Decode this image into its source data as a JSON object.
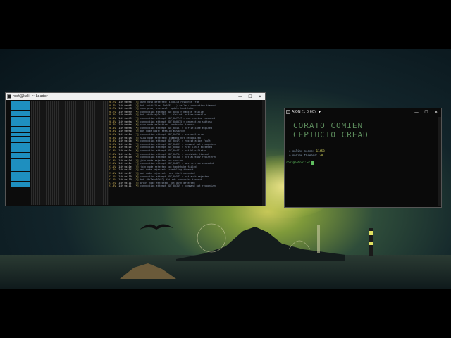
{
  "left_window": {
    "title": "root@kali: ~ Loader",
    "controls": [
      "—",
      "☐",
      "✕"
    ],
    "log": [
      {
        "pct": "20.7%",
        "time": "[14H 0x0f8]",
        "tag": "[!]",
        "msg": "auth host detected: invalid response from"
      },
      {
        "pct": "20.7%",
        "time": "[14H 0x0f8]",
        "tag": "[!]",
        "msg": "bot initialize( 0xA7F... ) failed: connection timeout"
      },
      {
        "pct": "20.7%",
        "time": "[14H 0x0f8]",
        "tag": "[!]",
        "msg": "node proxy protocol: update handshake"
      },
      {
        "pct": "20.7%",
        "time": "[14H 0x0f9]",
        "tag": "[*]",
        "msg": "connection attempt BOT_0x51 > handle resolve"
      },
      {
        "pct": "20.8%",
        "time": "[14H 0x0f9]",
        "tag": "[!]",
        "msg": "bot id:0x4e(0xA3F0...) failed: buffer overflow"
      },
      {
        "pct": "20.8%",
        "time": "[14H 0x0f9]",
        "tag": "[*]",
        "msg": "connection attempt BOT_0x7747 > new routine executed"
      },
      {
        "pct": "20.8%",
        "time": "[14H 0x0fa]",
        "tag": "[*]",
        "msg": "connection attempt BOT_0x0535 > generating subtask"
      },
      {
        "pct": "20.8%",
        "time": "[14H 0x0fa]",
        "tag": "[*]",
        "msg": "scan node selection: handshake timeout"
      },
      {
        "pct": "20.8%",
        "time": "[14H 0x0fa]",
        "tag": "[*]",
        "msg": "connection attempt BOT_0x431 > certificate expired"
      },
      {
        "pct": "20.9%",
        "time": "[14H 0x0fb]",
        "tag": "[!]",
        "msg": "bot node host: session mismatch"
      },
      {
        "pct": "20.9%",
        "time": "[14H 0x10a]",
        "tag": "[*]",
        "msg": "connection attempt BOT_0x718 > protocol error"
      },
      {
        "pct": "20.9%",
        "time": "[14H 0x10a]",
        "tag": "[!]",
        "msg": "slow node rejected: command not recognized"
      },
      {
        "pct": "20.9%",
        "time": "[14H 0x10b]",
        "tag": "[*]",
        "msg": "connection attempt BOT_0x473 > registration fault"
      },
      {
        "pct": "20.9%",
        "time": "[14H 0x10b]",
        "tag": "[*]",
        "msg": "connection attempt BOT_0x661 > command not recognized"
      },
      {
        "pct": "20.9%",
        "time": "[14H 0x10c]",
        "tag": "[*]",
        "msg": "connection attempt BOT_0x845 > rate limit exceeded"
      },
      {
        "pct": "21.0%",
        "time": "[14H 0x10c]",
        "tag": "[*]",
        "msg": "connection attempt BOT_0x471 > not blacklisted"
      },
      {
        "pct": "21.0%",
        "time": "[14H 0x10c]",
        "tag": "[*]",
        "msg": "connection attempt BOT_0x714 > handshake timeout"
      },
      {
        "pct": "21.0%",
        "time": "[14H 0x10d]",
        "tag": "[*]",
        "msg": "connection attempt BOT_0x318 > not already registered"
      },
      {
        "pct": "21.0%",
        "time": "[14H 0x10d]",
        "tag": "[!]",
        "msg": "join node rejected not routine"
      },
      {
        "pct": "21.1%",
        "time": "[14H 0x10e]",
        "tag": "[*]",
        "msg": "connection attempt BOT_0x877 > max retries exceeded"
      },
      {
        "pct": "21.1%",
        "time": "[14H 0x10e]",
        "tag": "[!]",
        "msg": "join node rejected not handshake failed"
      },
      {
        "pct": "21.1%",
        "time": "[14H 0x10f]",
        "tag": "[!]",
        "msg": "api node rejected: scheduling timeout"
      },
      {
        "pct": "21.1%",
        "time": "[14H 0x10f]",
        "tag": "[!]",
        "msg": "api node rejected: rate limit exceeded"
      },
      {
        "pct": "21.2%",
        "time": "[14H 0x110]",
        "tag": "[*]",
        "msg": "connection attempt BOT_0x573 > not auth rejected"
      },
      {
        "pct": "21.2%",
        "time": "[14H 0x110]",
        "tag": "[!]",
        "msg": "bot (0x7a0c80b22) failed: handshake timeout"
      },
      {
        "pct": "21.2%",
        "time": "[14H 0x111]",
        "tag": "[!]",
        "msg": "proxy node rejected: not auth detected"
      },
      {
        "pct": "21.3%",
        "time": "[14H 0x111]",
        "tag": "[*]",
        "msg": "connection attempt BOT_0x319 > command not recognized"
      }
    ]
  },
  "right_window": {
    "title": "AION (1 0 60)",
    "controls": [
      "—",
      "☐",
      "✕"
    ],
    "banner_line1": "CORATO COMIEN",
    "banner_line2": "CEPTUCTO CREAD",
    "stats": [
      {
        "label": "online nodes:",
        "value": "11458"
      },
      {
        "label": "online threads:",
        "value": "28"
      }
    ],
    "prompt": "root@botnet:~# "
  }
}
